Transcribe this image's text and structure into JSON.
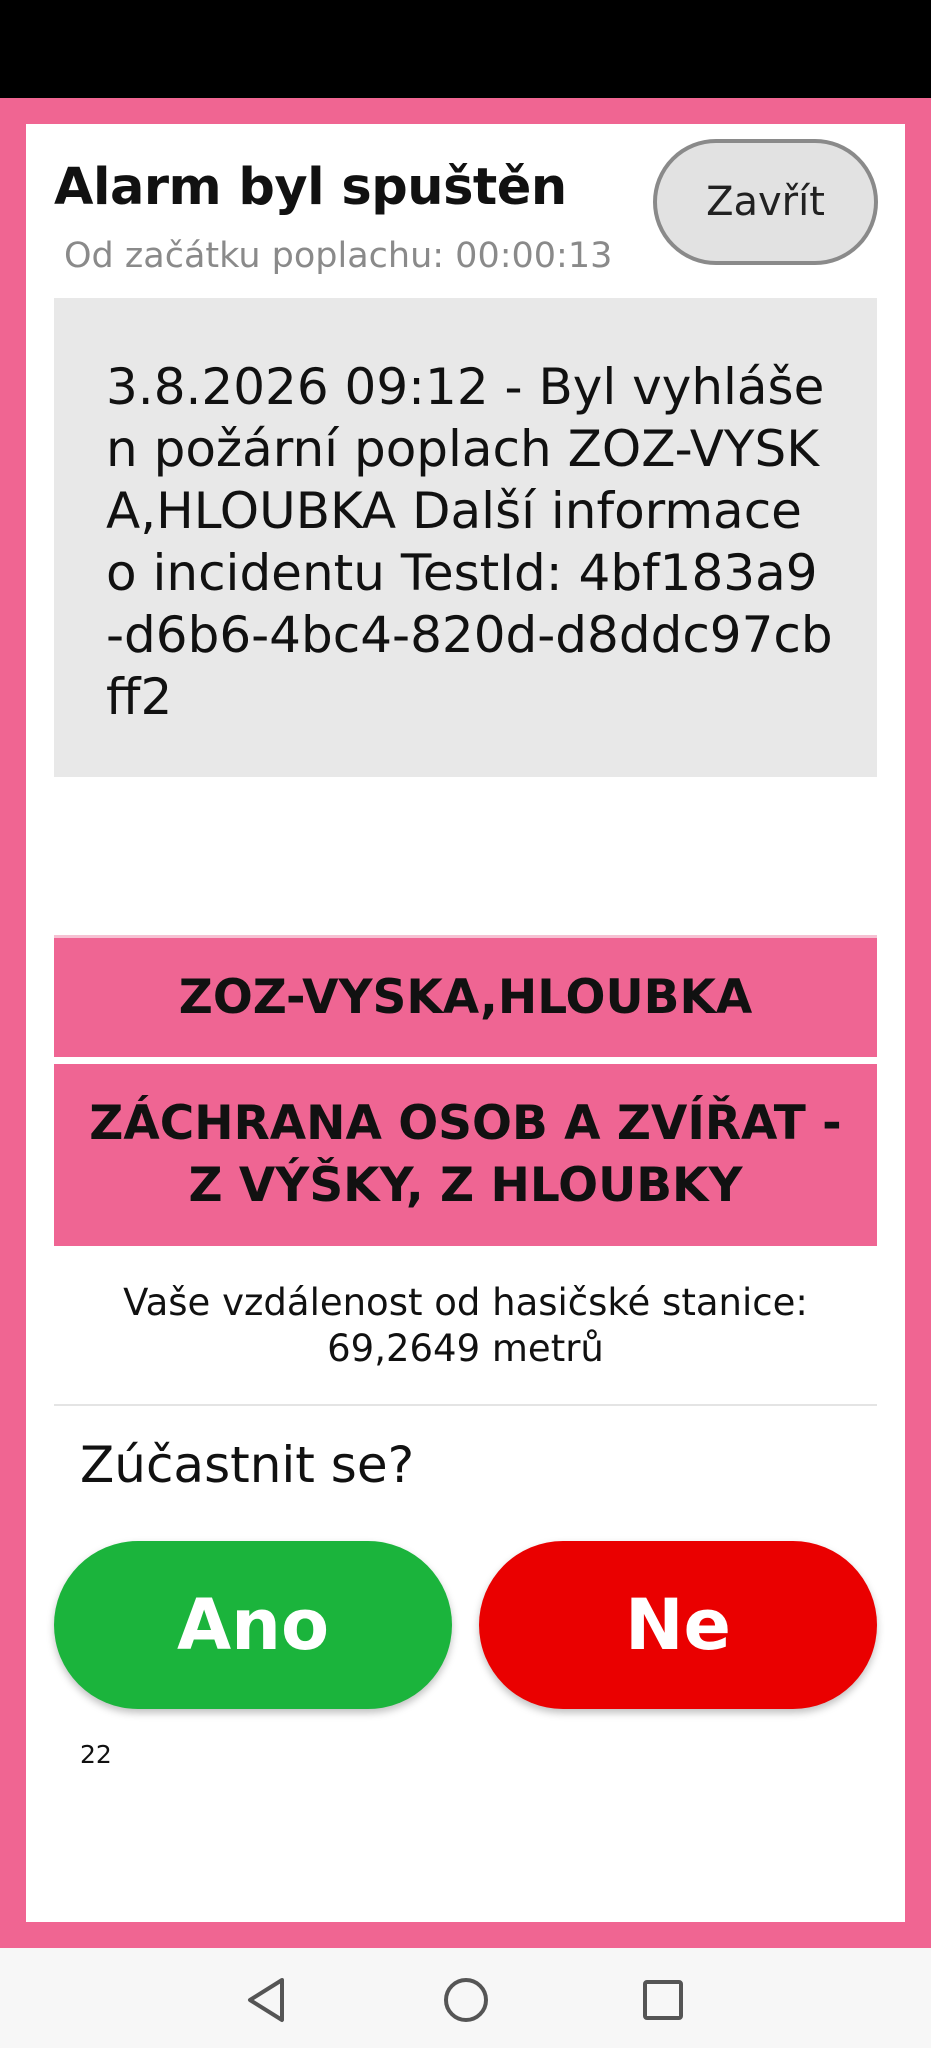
{
  "header": {
    "title": "Alarm byl spuštěn",
    "elapsed": "Od začátku poplachu: 00:00:13",
    "close_label": "Zavřít"
  },
  "message": {
    "text": "3.8.2026 09:12 - Byl vyhlášen požární poplach ZOZ-VYSKA,HLOUBKA Další informace o incidentu TestId: 4bf183a9-d6b6-4bc4-820d-d8ddc97cbff2"
  },
  "incident": {
    "code": "ZOZ-VYSKA,HLOUBKA",
    "type": "ZÁCHRANA OSOB A ZVÍŘAT - Z VÝŠKY, Z HLOUBKY"
  },
  "distance": {
    "line1": "Vaše vzdálenost od hasičské stanice:",
    "line2": "69,2649 metrů"
  },
  "participation": {
    "question": "Zúčastnit se?",
    "yes_label": "Ano",
    "no_label": "Ne"
  },
  "footer": {
    "counter": "22"
  },
  "colors": {
    "frame": "#f06592",
    "yes": "#1bb43c",
    "no": "#ea0000"
  },
  "icons": {
    "nav_back": "triangle-back-icon",
    "nav_home": "circle-home-icon",
    "nav_recent": "square-recents-icon"
  }
}
